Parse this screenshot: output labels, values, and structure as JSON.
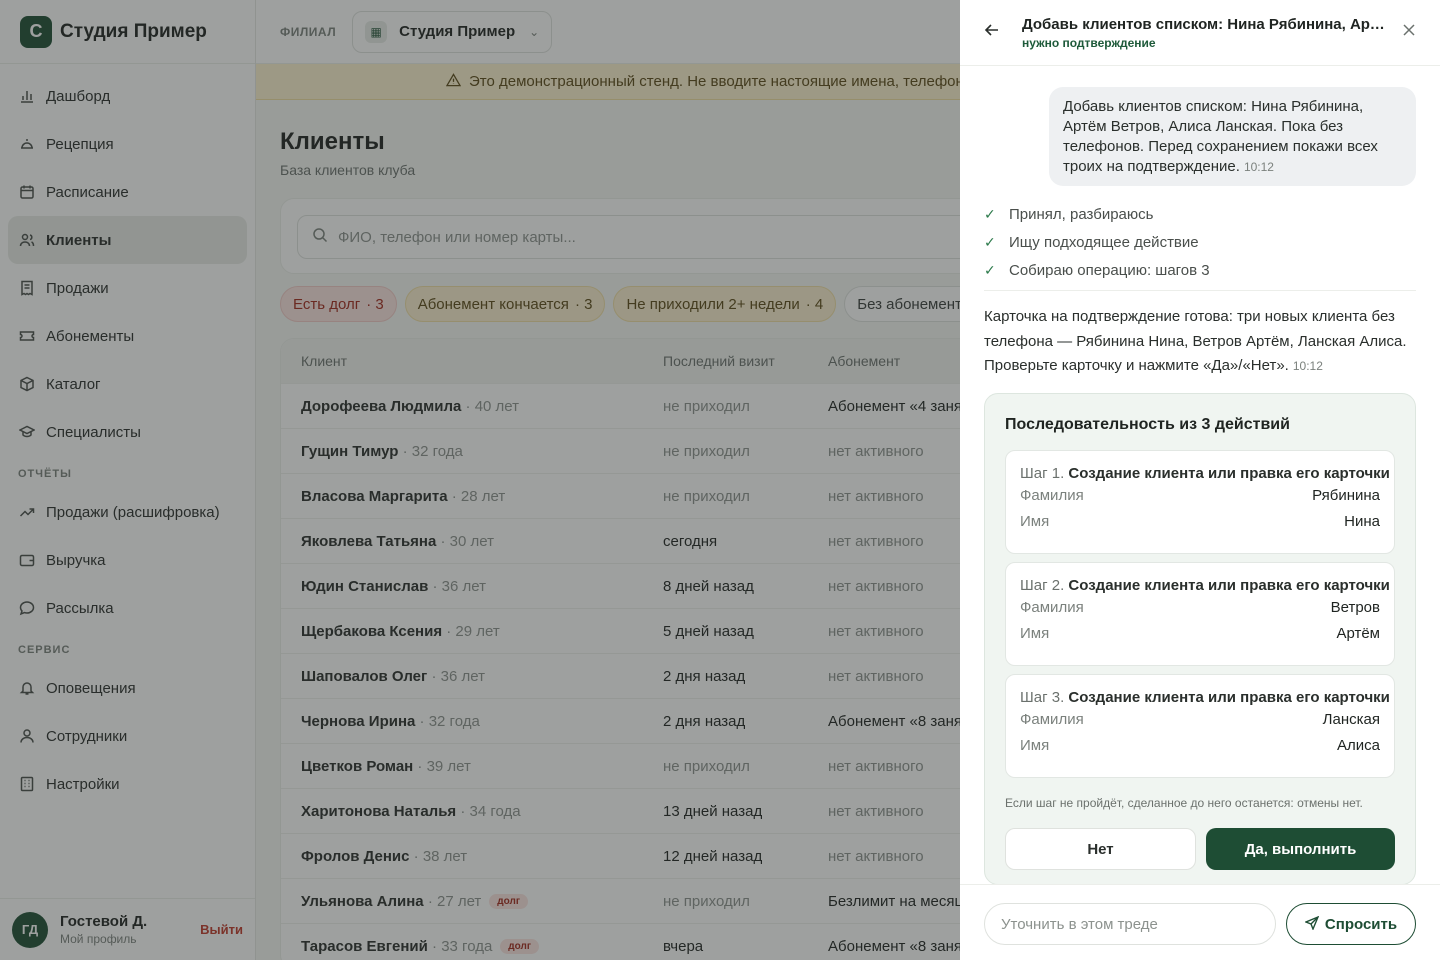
{
  "brand": {
    "logo_letter": "С",
    "name": "Студия Пример"
  },
  "nav": {
    "main_items": [
      {
        "label": "Дашборд",
        "icon": "chart-bar-icon"
      },
      {
        "label": "Рецепция",
        "icon": "bell-desk-icon"
      },
      {
        "label": "Расписание",
        "icon": "calendar-icon"
      },
      {
        "label": "Клиенты",
        "icon": "users-icon",
        "active": true
      },
      {
        "label": "Продажи",
        "icon": "receipt-icon"
      },
      {
        "label": "Абонементы",
        "icon": "ticket-icon"
      },
      {
        "label": "Каталог",
        "icon": "box-icon"
      },
      {
        "label": "Специалисты",
        "icon": "graduation-cap-icon"
      }
    ],
    "reports_section": "ОТЧЁТЫ",
    "report_items": [
      {
        "label": "Продажи (расшифровка)",
        "icon": "trend-icon"
      },
      {
        "label": "Выручка",
        "icon": "wallet-icon"
      },
      {
        "label": "Рассылка",
        "icon": "message-icon"
      }
    ],
    "service_section": "СЕРВИС",
    "service_items": [
      {
        "label": "Оповещения",
        "icon": "bell-icon"
      },
      {
        "label": "Сотрудники",
        "icon": "user-icon"
      },
      {
        "label": "Настройки",
        "icon": "building-icon"
      }
    ]
  },
  "user": {
    "initials": "ГД",
    "name": "Гостевой Д.",
    "profile": "Мой профиль",
    "logout": "Выйти"
  },
  "topbar": {
    "branch_label": "ФИЛИАЛ",
    "branch_name": "Студия Пример"
  },
  "banner": {
    "text": "Это демонстрационный стенд. Не вводите настоящие имена, телефоны"
  },
  "page": {
    "title": "Клиенты",
    "subtitle": "База клиентов клуба"
  },
  "search": {
    "placeholder": "ФИО, телефон или номер карты..."
  },
  "filters": [
    {
      "label": "Есть долг",
      "count": "· 3",
      "tone": "red"
    },
    {
      "label": "Абонемент кончается",
      "count": "· 3",
      "tone": "yellow"
    },
    {
      "label": "Не приходили 2+ недели",
      "count": "· 4",
      "tone": "yellow"
    },
    {
      "label": "Без абонемента",
      "count": "",
      "tone": "gray"
    }
  ],
  "table": {
    "headers": [
      "Клиент",
      "Последний визит",
      "Абонемент"
    ],
    "rows": [
      {
        "name": "Дорофеева Людмила",
        "age": "· 40 лет",
        "visit": "не приходил",
        "sub": "Абонемент «4 заня",
        "debt": ""
      },
      {
        "name": "Гущин Тимур",
        "age": "· 32 года",
        "visit": "не приходил",
        "sub": "нет активного",
        "debt": ""
      },
      {
        "name": "Власова Маргарита",
        "age": "· 28 лет",
        "visit": "не приходил",
        "sub": "нет активного",
        "debt": ""
      },
      {
        "name": "Яковлева Татьяна",
        "age": "· 30 лет",
        "visit": "сегодня",
        "sub": "нет активного",
        "debt": ""
      },
      {
        "name": "Юдин Станислав",
        "age": "· 36 лет",
        "visit": "8 дней назад",
        "sub": "нет активного",
        "debt": ""
      },
      {
        "name": "Щербакова Ксения",
        "age": "· 29 лет",
        "visit": "5 дней назад",
        "sub": "нет активного",
        "debt": ""
      },
      {
        "name": "Шаповалов Олег",
        "age": "· 36 лет",
        "visit": "2 дня назад",
        "sub": "нет активного",
        "debt": ""
      },
      {
        "name": "Чернова Ирина",
        "age": "· 32 года",
        "visit": "2 дня назад",
        "sub": "Абонемент «8 заня",
        "debt": ""
      },
      {
        "name": "Цветков Роман",
        "age": "· 39 лет",
        "visit": "не приходил",
        "sub": "нет активного",
        "debt": ""
      },
      {
        "name": "Харитонова Наталья",
        "age": "· 34 года",
        "visit": "13 дней назад",
        "sub": "нет активного",
        "debt": ""
      },
      {
        "name": "Фролов Денис",
        "age": "· 38 лет",
        "visit": "12 дней назад",
        "sub": "нет активного",
        "debt": ""
      },
      {
        "name": "Ульянова Алина",
        "age": "· 27 лет",
        "visit": "не приходил",
        "sub": "Безлимит на месяц",
        "debt": "долг"
      },
      {
        "name": "Тарасов Евгений",
        "age": "· 33 года",
        "visit": "вчера",
        "sub": "Абонемент «8 заня",
        "debt": "долг"
      }
    ]
  },
  "panel": {
    "title": "Добавь клиентов списком: Нина Рябинина, Артём Ветров, Алиса Ланская. Пока без телефонов.",
    "status": "нужно подтверждение",
    "user_message": "Добавь клиентов списком: Нина Рябинина, Артём Ветров, Алиса Ланская. Пока без телефонов. Перед сохранением покажи всех троих на подтверждение.",
    "user_time": "10:12",
    "progress": [
      "Принял, разбираюсь",
      "Ищу подходящее действие",
      "Собираю операцию: шагов 3"
    ],
    "answer": "Карточка на подтверждение готова: три новых клиента без телефона — Рябинина Нина, Ветров Артём, Ланская Алиса. Проверьте карточку и нажмите «Да»/«Нет».",
    "answer_time": "10:12",
    "sequence_title": "Последовательность из 3 действий",
    "steps": [
      {
        "num": "Шаг 1.",
        "title": "Создание клиента или правка его карточки",
        "fields": [
          {
            "k": "Фамилия",
            "v": "Рябинина"
          },
          {
            "k": "Имя",
            "v": "Нина"
          }
        ]
      },
      {
        "num": "Шаг 2.",
        "title": "Создание клиента или правка его карточки",
        "fields": [
          {
            "k": "Фамилия",
            "v": "Ветров"
          },
          {
            "k": "Имя",
            "v": "Артём"
          }
        ]
      },
      {
        "num": "Шаг 3.",
        "title": "Создание клиента или правка его карточки",
        "fields": [
          {
            "k": "Фамилия",
            "v": "Ланская"
          },
          {
            "k": "Имя",
            "v": "Алиса"
          }
        ]
      }
    ],
    "note": "Если шаг не пройдёт, сделанное до него останется: отмены нет.",
    "no_label": "Нет",
    "yes_label": "Да, выполнить",
    "compose_placeholder": "Уточнить в этом треде",
    "ask_label": "Спросить"
  },
  "colors": {
    "accent": "#1e4d34",
    "danger": "#c0392b",
    "warning_bg": "#fdf2cf"
  }
}
